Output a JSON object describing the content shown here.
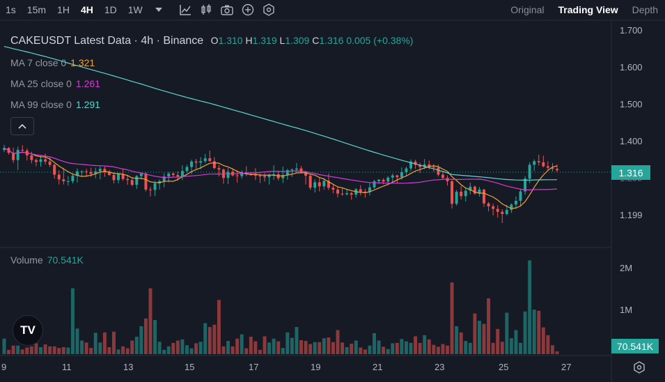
{
  "toolbar": {
    "timeframes": [
      "1s",
      "15m",
      "1H",
      "4H",
      "1D",
      "1W"
    ],
    "active_timeframe": "4H",
    "icons": [
      "chevron-down-icon",
      "line-chart-icon",
      "candles-icon",
      "camera-icon",
      "plus-circle-icon",
      "settings-hex-icon"
    ]
  },
  "views": {
    "original": "Original",
    "trading_view": "Trading View",
    "depth": "Depth"
  },
  "legend": {
    "symbol": "CAKEUSDT Latest Data · 4h · Binance",
    "open_label": "O",
    "open": "1.310",
    "high_label": "H",
    "high": "1.319",
    "low_label": "L",
    "low": "1.309",
    "close_label": "C",
    "close": "1.316",
    "change": "0.005",
    "change_pct": "(+0.38%)"
  },
  "ma": [
    {
      "label": "MA 7 close 0",
      "value": "1.321",
      "color": "#f0a33a"
    },
    {
      "label": "MA 25 close 0",
      "value": "1.261",
      "color": "#d63ad8"
    },
    {
      "label": "MA 99 close 0",
      "value": "1.291",
      "color": "#5bd6d0"
    }
  ],
  "volume_legend": {
    "label": "Volume",
    "value": "70.541K"
  },
  "price_axis": [
    "1.700",
    "1.600",
    "1.500",
    "1.400",
    "1.299",
    "1.199"
  ],
  "current_price": "1.316",
  "volume_axis": [
    "2M",
    "1M"
  ],
  "current_volume": "70.541K",
  "date_axis": [
    "9",
    "11",
    "13",
    "15",
    "17",
    "19",
    "21",
    "23",
    "25",
    "27"
  ],
  "logo_text": "TV",
  "colors": {
    "up": "#26a69a",
    "down": "#ef5350",
    "background": "#161a25"
  },
  "chart_data": {
    "type": "candlestick",
    "ylim": [
      1.17,
      1.71
    ],
    "volume_ylim": [
      0,
      2700000
    ],
    "up_candle_color": "#26a69a",
    "down_candle_color": "#ef5350",
    "candles": [
      [
        1.371,
        1.385,
        1.365,
        1.376,
        400000
      ],
      [
        1.376,
        1.379,
        1.358,
        1.363,
        110000
      ],
      [
        1.363,
        1.377,
        1.335,
        1.343,
        220000
      ],
      [
        1.343,
        1.38,
        1.316,
        1.371,
        220000
      ],
      [
        1.371,
        1.384,
        1.363,
        1.369,
        120000
      ],
      [
        1.369,
        1.375,
        1.342,
        1.356,
        170000
      ],
      [
        1.356,
        1.366,
        1.334,
        1.343,
        200000
      ],
      [
        1.343,
        1.348,
        1.326,
        1.338,
        280000
      ],
      [
        1.338,
        1.357,
        1.325,
        1.345,
        180000
      ],
      [
        1.345,
        1.361,
        1.331,
        1.339,
        250000
      ],
      [
        1.339,
        1.353,
        1.324,
        1.33,
        200000
      ],
      [
        1.33,
        1.333,
        1.292,
        1.303,
        200000
      ],
      [
        1.303,
        1.315,
        1.276,
        1.29,
        160000
      ],
      [
        1.29,
        1.322,
        1.276,
        1.285,
        180000
      ],
      [
        1.285,
        1.299,
        1.273,
        1.285,
        170000
      ],
      [
        1.285,
        1.304,
        1.279,
        1.3,
        1700000
      ],
      [
        1.3,
        1.32,
        1.281,
        1.312,
        660000
      ],
      [
        1.312,
        1.315,
        1.298,
        1.312,
        350000
      ],
      [
        1.312,
        1.319,
        1.297,
        1.31,
        300000
      ],
      [
        1.31,
        1.322,
        1.297,
        1.305,
        160000
      ],
      [
        1.305,
        1.322,
        1.293,
        1.312,
        550000
      ],
      [
        1.312,
        1.326,
        1.29,
        1.319,
        300000
      ],
      [
        1.319,
        1.325,
        1.297,
        1.311,
        560000
      ],
      [
        1.311,
        1.316,
        1.3,
        1.302,
        180000
      ],
      [
        1.302,
        1.309,
        1.279,
        1.288,
        580000
      ],
      [
        1.288,
        1.307,
        1.279,
        1.305,
        120000
      ],
      [
        1.305,
        1.32,
        1.286,
        1.291,
        200000
      ],
      [
        1.291,
        1.303,
        1.275,
        1.288,
        150000
      ],
      [
        1.288,
        1.296,
        1.271,
        1.275,
        350000
      ],
      [
        1.275,
        1.302,
        1.264,
        1.299,
        450000
      ],
      [
        1.299,
        1.309,
        1.289,
        1.306,
        720000
      ],
      [
        1.306,
        1.31,
        1.257,
        1.262,
        920000
      ],
      [
        1.262,
        1.27,
        1.243,
        1.261,
        1700000
      ],
      [
        1.261,
        1.286,
        1.244,
        1.279,
        880000
      ],
      [
        1.279,
        1.29,
        1.262,
        1.285,
        320000
      ],
      [
        1.285,
        1.307,
        1.268,
        1.298,
        110000
      ],
      [
        1.298,
        1.311,
        1.282,
        1.306,
        200000
      ],
      [
        1.306,
        1.309,
        1.296,
        1.302,
        290000
      ],
      [
        1.302,
        1.312,
        1.286,
        1.298,
        350000
      ],
      [
        1.298,
        1.329,
        1.288,
        1.313,
        380000
      ],
      [
        1.313,
        1.33,
        1.307,
        1.324,
        230000
      ],
      [
        1.324,
        1.344,
        1.304,
        1.339,
        150000
      ],
      [
        1.339,
        1.346,
        1.318,
        1.336,
        280000
      ],
      [
        1.336,
        1.351,
        1.318,
        1.34,
        320000
      ],
      [
        1.34,
        1.36,
        1.335,
        1.348,
        800000
      ],
      [
        1.348,
        1.369,
        1.339,
        1.34,
        700000
      ],
      [
        1.34,
        1.351,
        1.318,
        1.321,
        760000
      ],
      [
        1.321,
        1.329,
        1.298,
        1.317,
        1400000
      ],
      [
        1.317,
        1.32,
        1.278,
        1.294,
        200000
      ],
      [
        1.294,
        1.321,
        1.277,
        1.311,
        340000
      ],
      [
        1.311,
        1.319,
        1.298,
        1.301,
        200000
      ],
      [
        1.301,
        1.315,
        1.281,
        1.299,
        400000
      ],
      [
        1.299,
        1.315,
        1.292,
        1.309,
        510000
      ],
      [
        1.309,
        1.326,
        1.299,
        1.305,
        150000
      ],
      [
        1.305,
        1.31,
        1.3,
        1.302,
        450000
      ],
      [
        1.302,
        1.321,
        1.288,
        1.3,
        330000
      ],
      [
        1.3,
        1.306,
        1.28,
        1.299,
        110000
      ],
      [
        1.299,
        1.307,
        1.284,
        1.296,
        460000
      ],
      [
        1.296,
        1.306,
        1.276,
        1.303,
        300000
      ],
      [
        1.303,
        1.329,
        1.289,
        1.304,
        400000
      ],
      [
        1.304,
        1.314,
        1.287,
        1.293,
        330000
      ],
      [
        1.293,
        1.325,
        1.28,
        1.302,
        160000
      ],
      [
        1.302,
        1.319,
        1.289,
        1.315,
        560000
      ],
      [
        1.315,
        1.32,
        1.297,
        1.317,
        420000
      ],
      [
        1.317,
        1.335,
        1.307,
        1.32,
        700000
      ],
      [
        1.32,
        1.327,
        1.306,
        1.31,
        360000
      ],
      [
        1.31,
        1.313,
        1.276,
        1.3,
        340000
      ],
      [
        1.3,
        1.305,
        1.261,
        1.267,
        260000
      ],
      [
        1.267,
        1.29,
        1.254,
        1.282,
        310000
      ],
      [
        1.282,
        1.295,
        1.257,
        1.271,
        310000
      ],
      [
        1.271,
        1.294,
        1.262,
        1.286,
        410000
      ],
      [
        1.286,
        1.306,
        1.261,
        1.267,
        430000
      ],
      [
        1.267,
        1.278,
        1.252,
        1.262,
        310000
      ],
      [
        1.262,
        1.269,
        1.241,
        1.251,
        620000
      ],
      [
        1.251,
        1.266,
        1.245,
        1.249,
        300000
      ],
      [
        1.249,
        1.264,
        1.246,
        1.252,
        180000
      ],
      [
        1.252,
        1.256,
        1.234,
        1.248,
        270000
      ],
      [
        1.248,
        1.266,
        1.24,
        1.263,
        350000
      ],
      [
        1.263,
        1.274,
        1.246,
        1.256,
        170000
      ],
      [
        1.256,
        1.264,
        1.24,
        1.255,
        120000
      ],
      [
        1.255,
        1.281,
        1.246,
        1.268,
        220000
      ],
      [
        1.268,
        1.289,
        1.264,
        1.285,
        540000
      ],
      [
        1.285,
        1.291,
        1.277,
        1.289,
        350000
      ],
      [
        1.289,
        1.293,
        1.277,
        1.284,
        190000
      ],
      [
        1.284,
        1.299,
        1.277,
        1.295,
        130000
      ],
      [
        1.295,
        1.306,
        1.283,
        1.301,
        280000
      ],
      [
        1.301,
        1.303,
        1.28,
        1.296,
        290000
      ],
      [
        1.296,
        1.323,
        1.289,
        1.31,
        390000
      ],
      [
        1.31,
        1.325,
        1.299,
        1.32,
        330000
      ],
      [
        1.32,
        1.345,
        1.313,
        1.339,
        290000
      ],
      [
        1.339,
        1.344,
        1.319,
        1.33,
        460000
      ],
      [
        1.33,
        1.336,
        1.308,
        1.324,
        290000
      ],
      [
        1.324,
        1.346,
        1.318,
        1.331,
        490000
      ],
      [
        1.331,
        1.342,
        1.318,
        1.324,
        380000
      ],
      [
        1.324,
        1.332,
        1.311,
        1.322,
        240000
      ],
      [
        1.322,
        1.331,
        1.298,
        1.303,
        190000
      ],
      [
        1.303,
        1.312,
        1.289,
        1.294,
        260000
      ],
      [
        1.294,
        1.301,
        1.273,
        1.285,
        220000
      ],
      [
        1.285,
        1.288,
        1.21,
        1.223,
        1850000
      ],
      [
        1.223,
        1.261,
        1.218,
        1.256,
        720000
      ],
      [
        1.256,
        1.272,
        1.235,
        1.244,
        560000
      ],
      [
        1.244,
        1.267,
        1.229,
        1.259,
        340000
      ],
      [
        1.259,
        1.281,
        1.249,
        1.27,
        290000
      ],
      [
        1.27,
        1.273,
        1.248,
        1.251,
        1050000
      ],
      [
        1.251,
        1.269,
        1.243,
        1.262,
        860000
      ],
      [
        1.262,
        1.264,
        1.215,
        1.224,
        780000
      ],
      [
        1.224,
        1.228,
        1.202,
        1.216,
        1440000
      ],
      [
        1.216,
        1.223,
        1.191,
        1.209,
        290000
      ],
      [
        1.209,
        1.219,
        1.185,
        1.201,
        650000
      ],
      [
        1.201,
        1.208,
        1.17,
        1.195,
        320000
      ],
      [
        1.195,
        1.22,
        1.191,
        1.206,
        1070000
      ],
      [
        1.206,
        1.224,
        1.198,
        1.221,
        410000
      ],
      [
        1.221,
        1.243,
        1.209,
        1.231,
        620000
      ],
      [
        1.231,
        1.263,
        1.215,
        1.257,
        290000
      ],
      [
        1.257,
        1.299,
        1.248,
        1.292,
        1100000
      ],
      [
        1.292,
        1.337,
        1.28,
        1.33,
        2420000
      ],
      [
        1.33,
        1.345,
        1.313,
        1.34,
        1150000
      ],
      [
        1.34,
        1.358,
        1.328,
        1.337,
        1120000
      ],
      [
        1.337,
        1.355,
        1.323,
        1.326,
        690000
      ],
      [
        1.326,
        1.34,
        1.314,
        1.322,
        490000
      ],
      [
        1.322,
        1.335,
        1.312,
        1.319,
        230000
      ],
      [
        1.319,
        1.331,
        1.31,
        1.315,
        70541
      ]
    ]
  }
}
